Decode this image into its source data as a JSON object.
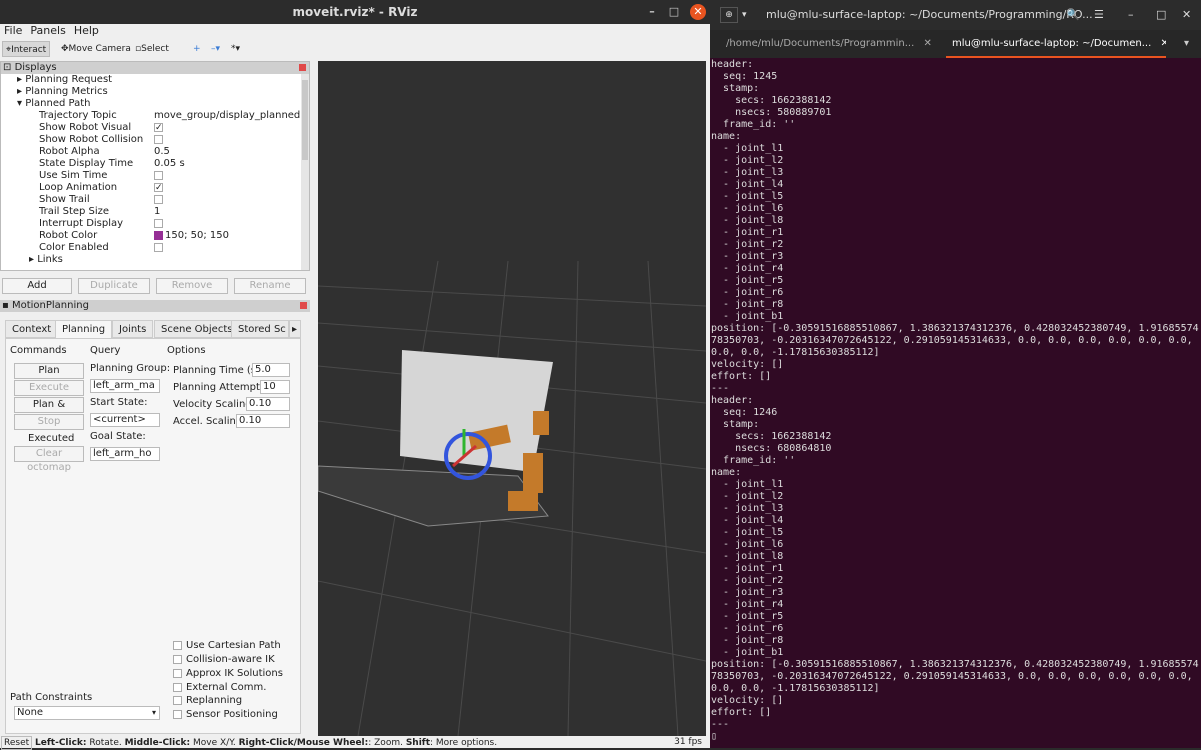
{
  "rviz": {
    "title": "moveit.rviz* - RViz",
    "menu": [
      "File",
      "Panels",
      "Help"
    ],
    "toolbar": {
      "interact": "Interact",
      "move_camera": "Move Camera",
      "select": "Select"
    },
    "displays": {
      "title": "Displays",
      "tree": [
        "Planning Request",
        "Planning Metrics",
        "Planned Path"
      ],
      "props": [
        {
          "k": "Trajectory Topic",
          "v": "move_group/display_planned..."
        },
        {
          "k": "Show Robot Visual",
          "v": "✓"
        },
        {
          "k": "Show Robot Collision",
          "v": ""
        },
        {
          "k": "Robot Alpha",
          "v": "0.5"
        },
        {
          "k": "State Display Time",
          "v": "0.05 s"
        },
        {
          "k": "Use Sim Time",
          "v": ""
        },
        {
          "k": "Loop Animation",
          "v": "✓"
        },
        {
          "k": "Show Trail",
          "v": ""
        },
        {
          "k": "Trail Step Size",
          "v": "1"
        },
        {
          "k": "Interrupt Display",
          "v": ""
        },
        {
          "k": "Robot Color",
          "v": "150; 50; 150"
        },
        {
          "k": "Color Enabled",
          "v": ""
        },
        {
          "k": "Links",
          "v": ""
        }
      ],
      "buttons": {
        "add": "Add",
        "duplicate": "Duplicate",
        "remove": "Remove",
        "rename": "Rename"
      }
    },
    "motion_planning": {
      "title": "MotionPlanning",
      "tabs": [
        "Context",
        "Planning",
        "Joints",
        "Scene Objects",
        "Stored Sc"
      ],
      "commands": {
        "title": "Commands",
        "plan": "Plan",
        "execute": "Execute",
        "plan_execute": "Plan & Execute",
        "stop": "Stop",
        "status": "Executed",
        "clear_octomap": "Clear octomap"
      },
      "query": {
        "title": "Query",
        "planning_group_label": "Planning Group:",
        "planning_group": "left_arm_ma",
        "start_state_label": "Start State:",
        "start_state": "<current>",
        "goal_state_label": "Goal State:",
        "goal_state": "left_arm_ho"
      },
      "options": {
        "title": "Options",
        "planning_time_label": "Planning Time (s):",
        "planning_time": "5.0",
        "planning_attempts_label": "Planning Attempts:",
        "planning_attempts": "10",
        "velocity_label": "Velocity Scaling:",
        "velocity": "0.10",
        "accel_label": "Accel. Scaling:",
        "accel": "0.10"
      },
      "checkboxes": [
        "Use Cartesian Path",
        "Collision-aware IK",
        "Approx IK Solutions",
        "External Comm.",
        "Replanning",
        "Sensor Positioning"
      ],
      "path_constraints_label": "Path Constraints",
      "path_constraints": "None"
    },
    "status": {
      "reset": "Reset",
      "hint_left": "Left-Click:",
      "hint_left_v": " Rotate. ",
      "hint_mid": "Middle-Click:",
      "hint_mid_v": " Move X/Y. ",
      "hint_right": "Right-Click/Mouse Wheel:",
      "hint_right_v": ": Zoom. ",
      "hint_shift": "Shift",
      "hint_shift_v": ": More options.",
      "fps": "31 fps"
    },
    "robot_color": "#962f96"
  },
  "terminal": {
    "title": "mlu@mlu-surface-laptop: ~/Documents/Programming/RO...",
    "tab1": "/home/mlu/Documents/Programmin...",
    "tab2": "mlu@mlu-surface-laptop: ~/Documen...",
    "text": "header:\n  seq: 1245\n  stamp:\n    secs: 1662388142\n    nsecs: 580889701\n  frame_id: ''\nname:\n  - joint_l1\n  - joint_l2\n  - joint_l3\n  - joint_l4\n  - joint_l5\n  - joint_l6\n  - joint_l8\n  - joint_r1\n  - joint_r2\n  - joint_r3\n  - joint_r4\n  - joint_r5\n  - joint_r6\n  - joint_r8\n  - joint_b1\nposition: [-0.30591516885510867, 1.386321374312376, 0.428032452380749, 1.9168557478350703, -0.20316347072645122, 0.291059145314633, 0.0, 0.0, 0.0, 0.0, 0.0, 0.0, 0.0, 0.0, -1.17815630385112]\nvelocity: []\neffort: []\n---\nheader:\n  seq: 1246\n  stamp:\n    secs: 1662388142\n    nsecs: 680864810\n  frame_id: ''\nname:\n  - joint_l1\n  - joint_l2\n  - joint_l3\n  - joint_l4\n  - joint_l5\n  - joint_l6\n  - joint_l8\n  - joint_r1\n  - joint_r2\n  - joint_r3\n  - joint_r4\n  - joint_r5\n  - joint_r6\n  - joint_r8\n  - joint_b1\nposition: [-0.30591516885510867, 1.386321374312376, 0.428032452380749, 1.9168557478350703, -0.20316347072645122, 0.291059145314633, 0.0, 0.0, 0.0, 0.0, 0.0, 0.0, 0.0, 0.0, -1.17815630385112]\nvelocity: []\neffort: []\n---\n▯"
  }
}
